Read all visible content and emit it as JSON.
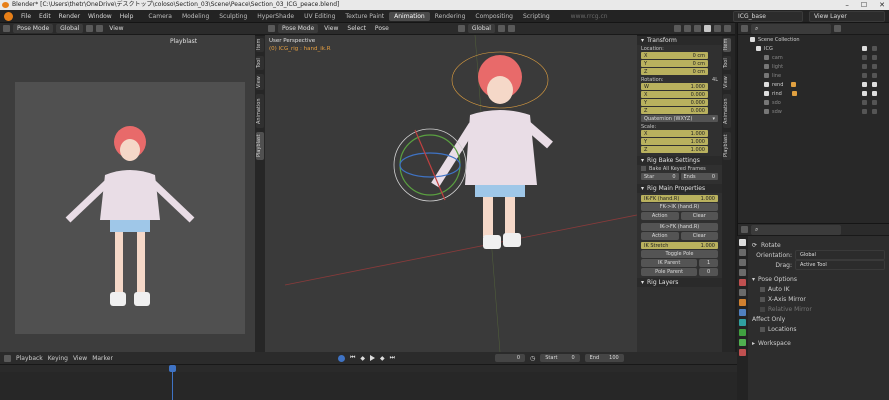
{
  "title": "Blender* [C:\\Users\\thetr\\OneDrive\\デスクトップ\\coloso\\Section_03\\Scene\\Peace\\Section_03_ICG_peace.blend]",
  "window_controls": {
    "min": "–",
    "max": "☐",
    "close": "✕"
  },
  "menu": [
    "File",
    "Edit",
    "Render",
    "Window",
    "Help"
  ],
  "workspaces": [
    "Camera",
    "Modeling",
    "Sculpting",
    "HyperShade",
    "UV Editing",
    "Texture Paint",
    "Animation",
    "Rendering",
    "Compositing",
    "Scripting"
  ],
  "active_workspace": "Animation",
  "watermark": "www.rrcg.cn",
  "scene": "ICG_base",
  "view_layer": "View Layer",
  "left_view": {
    "mode": "Pose Mode",
    "orient": "Global",
    "menus": [
      "View"
    ],
    "overlay_label": "Playblast"
  },
  "main_view": {
    "mode": "Pose Mode",
    "menus": [
      "View",
      "Select",
      "Pose"
    ],
    "orient": "Global",
    "perspective": "User Perspective",
    "active": "(0) ICG_rig : hand_ik.R"
  },
  "left_tabs": [
    "Item",
    "Tool",
    "View",
    "Animation",
    "Playblast"
  ],
  "right_tabs": [
    "Item",
    "Tool",
    "View",
    "Animation",
    "Playblast"
  ],
  "transform": {
    "title": "Transform",
    "location_label": "Location:",
    "location": [
      {
        "axis": "X",
        "value": "0 cm"
      },
      {
        "axis": "Y",
        "value": "0 cm"
      },
      {
        "axis": "Z",
        "value": "0 cm"
      }
    ],
    "rotation_label": "Rotation:",
    "rotation_tag": "4L",
    "rotation": [
      {
        "axis": "W",
        "value": "1.000"
      },
      {
        "axis": "X",
        "value": "0.000"
      },
      {
        "axis": "Y",
        "value": "0.000"
      },
      {
        "axis": "Z",
        "value": "0.000"
      }
    ],
    "rot_mode": "Quaternion (WXYZ)",
    "scale_label": "Scale:",
    "scale": [
      {
        "axis": "X",
        "value": "1.000"
      },
      {
        "axis": "Y",
        "value": "1.000"
      },
      {
        "axis": "Z",
        "value": "1.000"
      }
    ]
  },
  "rig_bake": {
    "title": "Rig Bake Settings",
    "bake_all": "Bake All Keyed Frames",
    "start_label": "Star",
    "start_value": "0",
    "end_label": "Ends",
    "end_value": "0"
  },
  "rig_main": {
    "title": "Rig Main Properties",
    "fk_field": {
      "label": "IK-FK (hand.R)",
      "value": "1.000"
    },
    "fk_to_ik": "FK->IK (hand.R)",
    "ik_to_fk": "IK->FK (hand.R)",
    "action": "Action",
    "clear": "Clear",
    "ik_stretch": {
      "label": "IK Stretch",
      "value": "1.000"
    },
    "toggle_pole": "Toggle Pole",
    "ik_parent": {
      "label": "IK Parent",
      "value": "1"
    },
    "pole_parent": {
      "label": "Pole Parent",
      "value": "0"
    },
    "rig_layers": "Rig Layers"
  },
  "outliner": {
    "root": "Scene Collection",
    "items": [
      {
        "name": "ICG",
        "color": "#e0e0e0",
        "on": true
      },
      {
        "name": "cam",
        "color": "#8a8a8a",
        "on": false
      },
      {
        "name": "light",
        "color": "#8a8a8a",
        "on": false
      },
      {
        "name": "line",
        "color": "#8a8a8a",
        "on": false
      },
      {
        "name": "rend",
        "color": "#e0e0e0",
        "on": true
      },
      {
        "name": "rind",
        "color": "#e0e0e0",
        "on": true
      },
      {
        "name": "sdo",
        "color": "#8a8a8a",
        "on": false
      },
      {
        "name": "sdw",
        "color": "#8a8a8a",
        "on": false
      }
    ]
  },
  "properties": {
    "section": "Rotate",
    "orientation_label": "Orientation:",
    "orientation_value": "Global",
    "drag_label": "Drag:",
    "drag_value": "Active Tool",
    "pose_options": "Pose Options",
    "auto_ik": "Auto IK",
    "x_mirror": "X-Axis Mirror",
    "relative_mirror": "Relative Mirror",
    "affect_only": "Affect Only",
    "locations": "Locations",
    "workspace": "Workspace"
  },
  "timeline": {
    "menus": [
      "Playback",
      "Keying",
      "View",
      "Marker"
    ],
    "current": "0",
    "start_label": "Start",
    "start": "0",
    "end_label": "End",
    "end": "100"
  }
}
